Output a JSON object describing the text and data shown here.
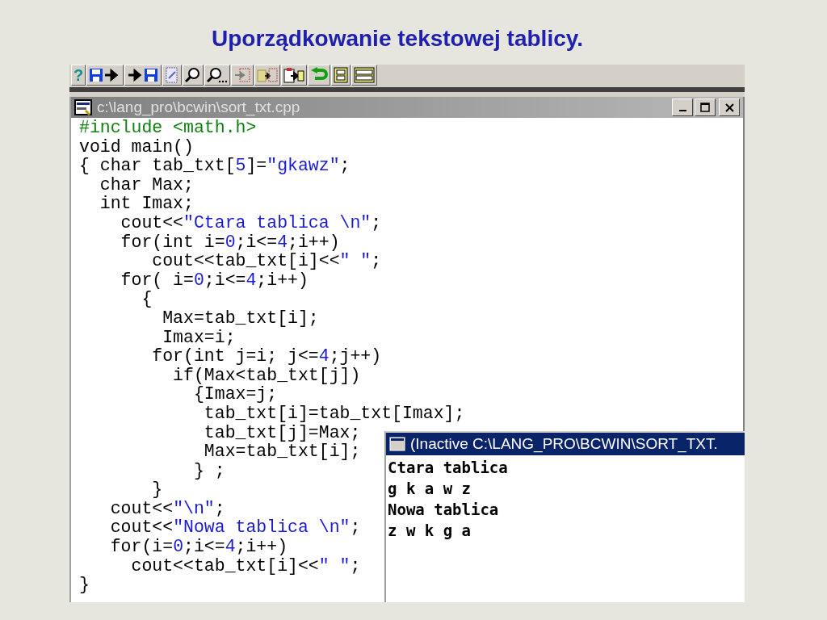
{
  "slide_title": "Uporządkowanie tekstowej tablicy.",
  "toolbar": [
    {
      "kind": "help",
      "label": "?"
    },
    {
      "kind": "save"
    },
    {
      "kind": "load"
    },
    {
      "kind": "edit"
    },
    {
      "kind": "find"
    },
    {
      "kind": "find_more"
    },
    {
      "kind": "move"
    },
    {
      "kind": "copy"
    },
    {
      "kind": "paste"
    },
    {
      "kind": "undo"
    },
    {
      "kind": "binary"
    },
    {
      "kind": "binary_wide"
    }
  ],
  "editor": {
    "title": "c:\\lang_pro\\bcwin\\sort_txt.cpp",
    "active": false,
    "lines": [
      [
        {
          "kind": "directive",
          "text": "#include <math.h>"
        }
      ],
      [
        {
          "kind": "plain",
          "text": "void main()"
        }
      ],
      [
        {
          "kind": "plain",
          "text": "{ char tab_txt["
        },
        {
          "kind": "number",
          "text": "5"
        },
        {
          "kind": "plain",
          "text": "]="
        },
        {
          "kind": "string",
          "text": "\"gkawz\""
        },
        {
          "kind": "plain",
          "text": ";"
        }
      ],
      [
        {
          "kind": "plain",
          "text": "  char Max;"
        }
      ],
      [
        {
          "kind": "plain",
          "text": "  int Imax;"
        }
      ],
      [
        {
          "kind": "plain",
          "text": "    cout<<"
        },
        {
          "kind": "string",
          "text": "\"Ctara tablica \\n\""
        },
        {
          "kind": "plain",
          "text": ";"
        }
      ],
      [
        {
          "kind": "plain",
          "text": "    for(int i="
        },
        {
          "kind": "number",
          "text": "0"
        },
        {
          "kind": "plain",
          "text": ";i<="
        },
        {
          "kind": "number",
          "text": "4"
        },
        {
          "kind": "plain",
          "text": ";i++)"
        }
      ],
      [
        {
          "kind": "plain",
          "text": "       cout<<tab_txt[i]<<"
        },
        {
          "kind": "string",
          "text": "\" \""
        },
        {
          "kind": "plain",
          "text": ";"
        }
      ],
      [
        {
          "kind": "plain",
          "text": "    for( i="
        },
        {
          "kind": "number",
          "text": "0"
        },
        {
          "kind": "plain",
          "text": ";i<="
        },
        {
          "kind": "number",
          "text": "4"
        },
        {
          "kind": "plain",
          "text": ";i++)"
        }
      ],
      [
        {
          "kind": "plain",
          "text": "      {"
        }
      ],
      [
        {
          "kind": "plain",
          "text": "        Max=tab_txt[i];"
        }
      ],
      [
        {
          "kind": "plain",
          "text": "        Imax=i;"
        }
      ],
      [
        {
          "kind": "plain",
          "text": "       for(int j=i; j<="
        },
        {
          "kind": "number",
          "text": "4"
        },
        {
          "kind": "plain",
          "text": ";j++)"
        }
      ],
      [
        {
          "kind": "plain",
          "text": "         if(Max<tab_txt[j])"
        }
      ],
      [
        {
          "kind": "plain",
          "text": "           {Imax=j;"
        }
      ],
      [
        {
          "kind": "plain",
          "text": "            tab_txt[i]=tab_txt[Imax];"
        }
      ],
      [
        {
          "kind": "plain",
          "text": "            tab_txt[j]=Max;"
        }
      ],
      [
        {
          "kind": "plain",
          "text": "            Max=tab_txt[i];"
        }
      ],
      [
        {
          "kind": "plain",
          "text": "           } ;"
        }
      ],
      [
        {
          "kind": "plain",
          "text": "       }"
        }
      ],
      [
        {
          "kind": "plain",
          "text": "   cout<<"
        },
        {
          "kind": "string",
          "text": "\"\\n\""
        },
        {
          "kind": "plain",
          "text": ";"
        }
      ],
      [
        {
          "kind": "plain",
          "text": "   cout<<"
        },
        {
          "kind": "string",
          "text": "\"Nowa tablica \\n\""
        },
        {
          "kind": "plain",
          "text": ";"
        }
      ],
      [
        {
          "kind": "plain",
          "text": "   for(i="
        },
        {
          "kind": "number",
          "text": "0"
        },
        {
          "kind": "plain",
          "text": ";i<="
        },
        {
          "kind": "number",
          "text": "4"
        },
        {
          "kind": "plain",
          "text": ";i++)"
        }
      ],
      [
        {
          "kind": "plain",
          "text": "     cout<<tab_txt[i]<<"
        },
        {
          "kind": "string",
          "text": "\" \""
        },
        {
          "kind": "plain",
          "text": ";"
        }
      ],
      [
        {
          "kind": "plain",
          "text": "}"
        }
      ]
    ]
  },
  "output": {
    "title": "(Inactive C:\\LANG_PRO\\BCWIN\\SORT_TXT.",
    "active": true,
    "lines": [
      "Ctara tablica",
      "g k a w z",
      "Nowa tablica",
      "z w k g a"
    ]
  }
}
